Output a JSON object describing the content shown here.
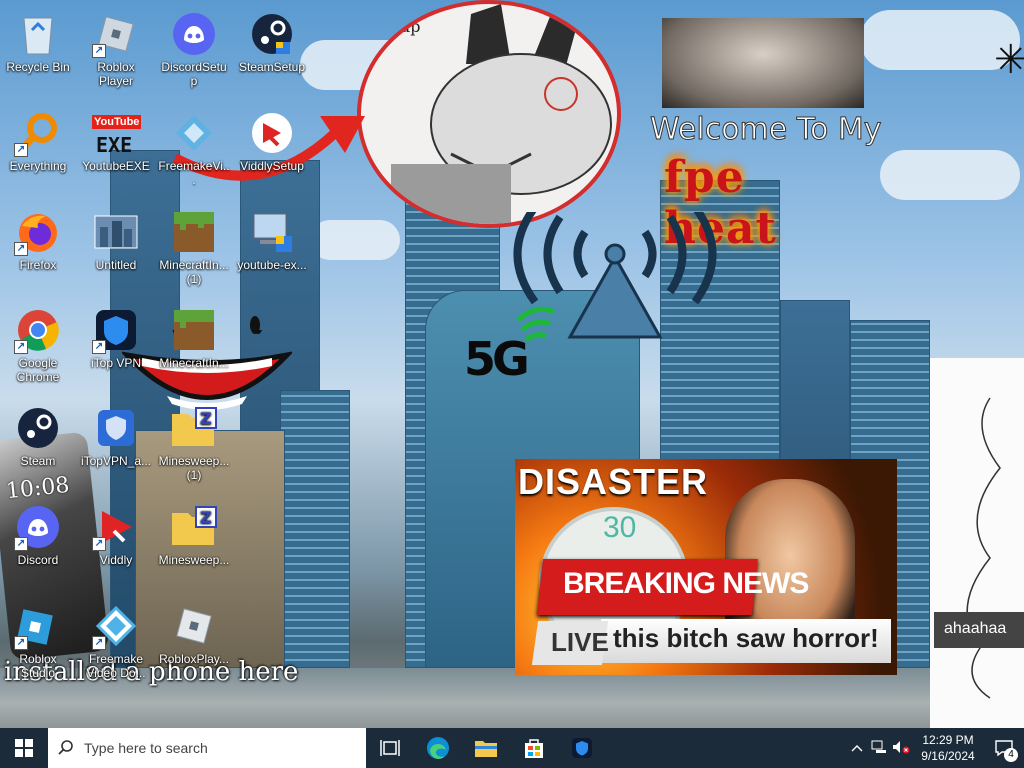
{
  "desktop": {
    "icons": [
      {
        "label": "Recycle Bin"
      },
      {
        "label": "Roblox Player"
      },
      {
        "label": "DiscordSetup"
      },
      {
        "label": "SteamSetup"
      },
      {
        "label": "Everything"
      },
      {
        "label": "YoutubeEXE"
      },
      {
        "label": "FreemakeVi..."
      },
      {
        "label": "ViddlySetup"
      },
      {
        "label": "Firefox"
      },
      {
        "label": "Untitled"
      },
      {
        "label": "MinecraftIn... (1)"
      },
      {
        "label": "youtube-ex..."
      },
      {
        "label": "Google Chrome"
      },
      {
        "label": "iTop VPN"
      },
      {
        "label": "MinecraftIn..."
      },
      {
        "label": "Steam"
      },
      {
        "label": "iTopVPN_a..."
      },
      {
        "label": "Minesweep... (1)"
      },
      {
        "label": "Discord"
      },
      {
        "label": "Viddly"
      },
      {
        "label": "Minesweep..."
      },
      {
        "label": "Roblox Studio"
      },
      {
        "label": "Freemake Video Do..."
      },
      {
        "label": "RobloxPlay..."
      }
    ],
    "welcome_text": "Welcome To My",
    "fire_text": "fpe heat",
    "sup_text": "Sup",
    "five_g": "5G",
    "news": {
      "disaster": "DISASTER",
      "clock_number": "30",
      "breaking": "BREAKING NEWS",
      "live": "LIVE",
      "ticker": "this bitch saw horror!"
    },
    "youtube_logo": "YouTube",
    "exe_logo": "EXE",
    "phone_time": "10:08",
    "caption": "installed a phone here",
    "side_text": "ahaahaa"
  },
  "taskbar": {
    "search_placeholder": "Type here to search",
    "time": "12:29 PM",
    "date": "9/16/2024",
    "notifications_count": "4"
  }
}
